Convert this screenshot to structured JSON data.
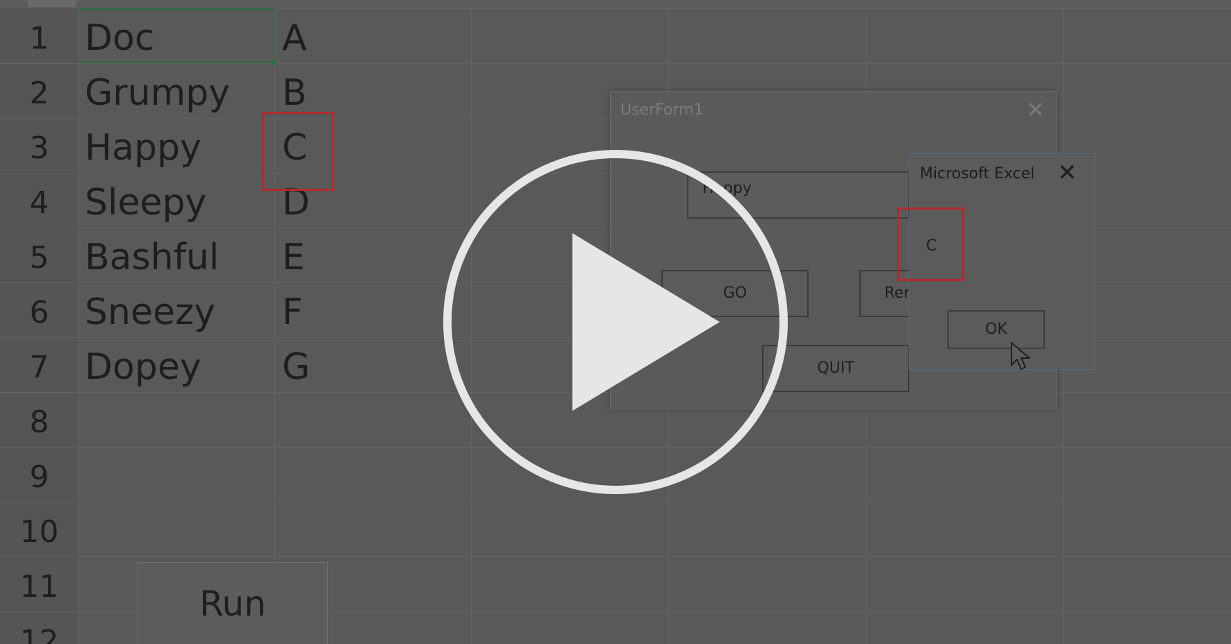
{
  "spreadsheet": {
    "row_numbers": [
      "1",
      "2",
      "3",
      "4",
      "5",
      "6",
      "7",
      "8",
      "9",
      "10",
      "11",
      "12"
    ],
    "col_a": [
      "Doc",
      "Grumpy",
      "Happy",
      "Sleepy",
      "Bashful",
      "Sneezy",
      "Dopey"
    ],
    "col_b": [
      "A",
      "B",
      "C",
      "D",
      "E",
      "F",
      "G"
    ],
    "run_button_label": "Run"
  },
  "userform": {
    "title": "UserForm1",
    "close_glyph": "✕",
    "textbox_value": "Happy",
    "go_label": "GO",
    "ren_label": "Ren",
    "quit_label": "QUIT"
  },
  "msgbox": {
    "title": "Microsoft Excel",
    "close_glyph": "✕",
    "message": "C",
    "ok_label": "OK"
  },
  "colors": {
    "highlight_red": "#b5282a",
    "selection_green": "#2b6e44",
    "overlay_white": "#e6e6e6"
  },
  "icons": {
    "play": "play-button-icon",
    "pointer": "mouse-pointer-icon"
  }
}
